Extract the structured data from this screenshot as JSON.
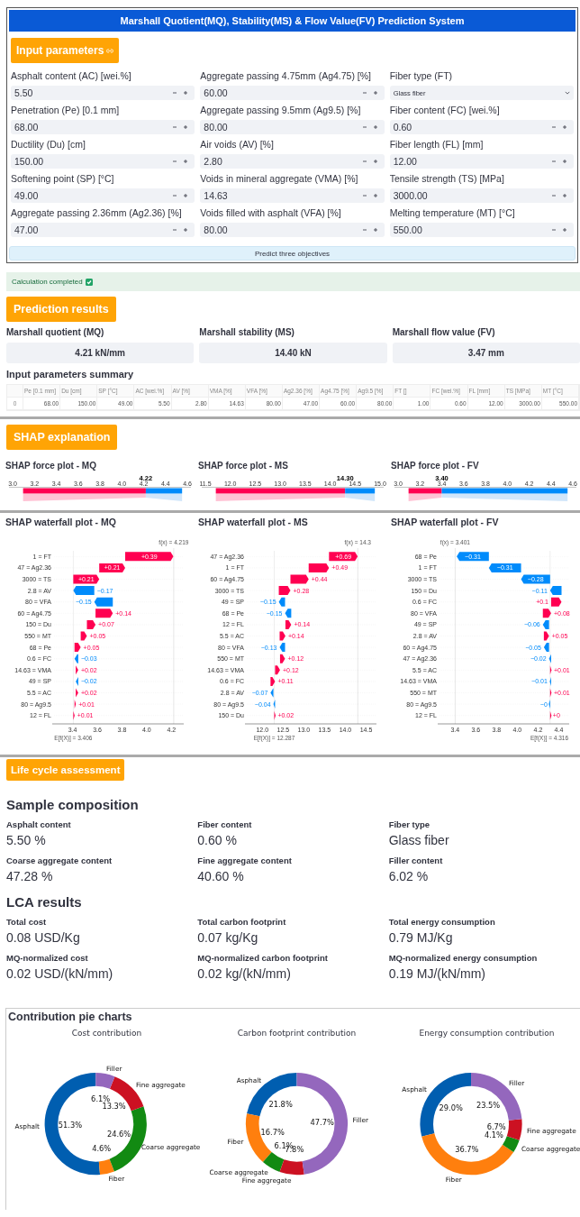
{
  "header": {
    "title": "Marshall Quotient(MQ), Stability(MS) & Flow Value(FV) Prediction System"
  },
  "input_section": {
    "badge": "Input parameters",
    "fields": [
      {
        "label": "Asphalt content (AC) [wei.%]",
        "value": "5.50",
        "kind": "number"
      },
      {
        "label": "Aggregate passing 4.75mm (Ag4.75) [%]",
        "value": "60.00",
        "kind": "number"
      },
      {
        "label": "Fiber type (FT)",
        "value": "Glass fiber",
        "kind": "select"
      },
      {
        "label": "Penetration (Pe) [0.1 mm]",
        "value": "68.00",
        "kind": "number"
      },
      {
        "label": "Aggregate passing 9.5mm (Ag9.5) [%]",
        "value": "80.00",
        "kind": "number"
      },
      {
        "label": "Fiber content (FC) [wei.%]",
        "value": "0.60",
        "kind": "number"
      },
      {
        "label": "Ductility (Du) [cm]",
        "value": "150.00",
        "kind": "number"
      },
      {
        "label": "Air voids (AV) [%]",
        "value": "2.80",
        "kind": "number"
      },
      {
        "label": "Fiber length (FL) [mm]",
        "value": "12.00",
        "kind": "number"
      },
      {
        "label": "Softening point (SP) [°C]",
        "value": "49.00",
        "kind": "number"
      },
      {
        "label": "Voids in mineral aggregate (VMA) [%]",
        "value": "14.63",
        "kind": "number"
      },
      {
        "label": "Tensile strength (TS) [MPa]",
        "value": "3000.00",
        "kind": "number"
      },
      {
        "label": "Aggregate passing 2.36mm (Ag2.36) [%]",
        "value": "47.00",
        "kind": "number"
      },
      {
        "label": "Voids filled with asphalt (VFA) [%]",
        "value": "80.00",
        "kind": "number"
      },
      {
        "label": "Melting temperature (MT) [°C]",
        "value": "550.00",
        "kind": "number"
      }
    ],
    "predict_button": "Predict three objectives"
  },
  "status": {
    "message": "Calculation completed"
  },
  "prediction_section": {
    "badge": "Prediction results",
    "results": [
      {
        "label": "Marshall quotient (MQ)",
        "value": "4.21 kN/mm"
      },
      {
        "label": "Marshall stability (MS)",
        "value": "14.40 kN"
      },
      {
        "label": "Marshall flow value (FV)",
        "value": "3.47 mm"
      }
    ],
    "summary_title": "Input parameters summary",
    "summary_table": {
      "columns": [
        "Pe [0.1 mm]",
        "Du [cm]",
        "SP [°C]",
        "AC [wei.%]",
        "AV [%]",
        "VMA [%]",
        "VFA [%]",
        "Ag2.36 [%]",
        "Ag4.75 [%]",
        "Ag9.5 [%]",
        "FT []",
        "FC [wei.%]",
        "FL [mm]",
        "TS [MPa]",
        "MT [°C]"
      ],
      "rows": [
        {
          "index": "0",
          "cells": [
            "68.00",
            "150.00",
            "49.00",
            "5.50",
            "2.80",
            "14.63",
            "80.00",
            "47.00",
            "60.00",
            "80.00",
            "1.00",
            "0.60",
            "12.00",
            "3000.00",
            "550.00"
          ]
        }
      ]
    }
  },
  "shap_section": {
    "badge": "SHAP explanation",
    "force_plots": [
      {
        "title": "SHAP force plot - MQ",
        "ticks": [
          "3.0",
          "3.2",
          "3.4",
          "3.6",
          "3.8",
          "4.0",
          "4.2",
          "4.4",
          "4.6"
        ],
        "output_label": "4.22"
      },
      {
        "title": "SHAP force plot - MS",
        "ticks": [
          "11.5",
          "12.0",
          "12.5",
          "13.0",
          "13.5",
          "14.0",
          "14.5",
          "15.0"
        ],
        "output_label": "14.30"
      },
      {
        "title": "SHAP force plot - FV",
        "ticks": [
          "3.0",
          "3.2",
          "3.4",
          "3.6",
          "3.8",
          "4.0",
          "4.2",
          "4.4",
          "4.6"
        ],
        "output_label": "3.40"
      }
    ],
    "waterfall_plots": [
      {
        "title": "SHAP waterfall plot - MQ",
        "output_label": "f(x) = 4.219",
        "base_label": "E[f(X)] = 3.406",
        "ticks": [
          "3.4",
          "3.6",
          "3.8",
          "4.0",
          "4.2"
        ],
        "rows": [
          {
            "feature": "1 = FT",
            "contribution": "+0.39"
          },
          {
            "feature": "47 = Ag2.36",
            "contribution": "+0.21"
          },
          {
            "feature": "3000 = TS",
            "contribution": "+0.21"
          },
          {
            "feature": "2.8 = AV",
            "contribution": "−0.17"
          },
          {
            "feature": "80 = VFA",
            "contribution": "−0.15"
          },
          {
            "feature": "60 = Ag4.75",
            "contribution": "+0.14"
          },
          {
            "feature": "150 = Du",
            "contribution": "+0.07"
          },
          {
            "feature": "550 = MT",
            "contribution": "+0.05"
          },
          {
            "feature": "68 = Pe",
            "contribution": "+0.05"
          },
          {
            "feature": "0.6 = FC",
            "contribution": "−0.03"
          },
          {
            "feature": "14.63 = VMA",
            "contribution": "+0.02"
          },
          {
            "feature": "49 = SP",
            "contribution": "−0.02"
          },
          {
            "feature": "5.5 = AC",
            "contribution": "+0.02"
          },
          {
            "feature": "80 = Ag9.5",
            "contribution": "+0.01"
          },
          {
            "feature": "12 = FL",
            "contribution": "+0.01"
          }
        ]
      },
      {
        "title": "SHAP waterfall plot - MS",
        "output_label": "f(x) = 14.3",
        "base_label": "E[f(X)] = 12.287",
        "ticks": [
          "12.0",
          "12.5",
          "13.0",
          "13.5",
          "14.0",
          "14.5"
        ],
        "rows": [
          {
            "feature": "47 = Ag2.36",
            "contribution": "+0.69"
          },
          {
            "feature": "1 = FT",
            "contribution": "+0.49"
          },
          {
            "feature": "60 = Ag4.75",
            "contribution": "+0.44"
          },
          {
            "feature": "3000 = TS",
            "contribution": "+0.28"
          },
          {
            "feature": "49 = SP",
            "contribution": "−0.15"
          },
          {
            "feature": "68 = Pe",
            "contribution": "−0.15"
          },
          {
            "feature": "12 = FL",
            "contribution": "+0.14"
          },
          {
            "feature": "5.5 = AC",
            "contribution": "+0.14"
          },
          {
            "feature": "80 = VFA",
            "contribution": "−0.13"
          },
          {
            "feature": "550 = MT",
            "contribution": "+0.12"
          },
          {
            "feature": "14.63 = VMA",
            "contribution": "+0.12"
          },
          {
            "feature": "0.6 = FC",
            "contribution": "+0.11"
          },
          {
            "feature": "2.8 = AV",
            "contribution": "−0.07"
          },
          {
            "feature": "80 = Ag9.5",
            "contribution": "−0.04"
          },
          {
            "feature": "150 = Du",
            "contribution": "+0.02"
          }
        ]
      },
      {
        "title": "SHAP waterfall plot - FV",
        "output_label": "f(x) = 3.401",
        "base_label": "E[f(X)] = 4.316",
        "ticks": [
          "3.4",
          "3.6",
          "3.8",
          "4.0",
          "4.2",
          "4.4"
        ],
        "rows": [
          {
            "feature": "68 = Pe",
            "contribution": "−0.31"
          },
          {
            "feature": "1 = FT",
            "contribution": "−0.31"
          },
          {
            "feature": "3000 = TS",
            "contribution": "−0.28"
          },
          {
            "feature": "150 = Du",
            "contribution": "−0.11"
          },
          {
            "feature": "0.6 = FC",
            "contribution": "+0.1"
          },
          {
            "feature": "80 = VFA",
            "contribution": "+0.08"
          },
          {
            "feature": "49 = SP",
            "contribution": "−0.06"
          },
          {
            "feature": "2.8 = AV",
            "contribution": "+0.05"
          },
          {
            "feature": "60 = Ag4.75",
            "contribution": "−0.05"
          },
          {
            "feature": "47 = Ag2.36",
            "contribution": "−0.02"
          },
          {
            "feature": "5.5 = AC",
            "contribution": "+0.01"
          },
          {
            "feature": "14.63 = VMA",
            "contribution": "−0.01"
          },
          {
            "feature": "550 = MT",
            "contribution": "+0.01"
          },
          {
            "feature": "80 = Ag9.5",
            "contribution": "−0"
          },
          {
            "feature": "12 = FL",
            "contribution": "+0"
          }
        ]
      }
    ]
  },
  "lca_section": {
    "badge": "Life cycle assessment",
    "groups": [
      {
        "title": "Sample composition",
        "metrics": [
          {
            "label": "Asphalt content",
            "value": "5.50 %"
          },
          {
            "label": "Fiber content",
            "value": "0.60 %"
          },
          {
            "label": "Fiber type",
            "value": "Glass fiber"
          },
          {
            "label": "Coarse aggregate content",
            "value": "47.28 %"
          },
          {
            "label": "Fine aggregate content",
            "value": "40.60 %"
          },
          {
            "label": "Filler content",
            "value": "6.02 %"
          }
        ]
      },
      {
        "title": "LCA results",
        "metrics": [
          {
            "label": "Total cost",
            "value": "0.08 USD/Kg"
          },
          {
            "label": "Total carbon footprint",
            "value": "0.07 kg/Kg"
          },
          {
            "label": "Total energy consumption",
            "value": "0.79 MJ/Kg"
          },
          {
            "label": "MQ-normalized cost",
            "value": "0.02 USD/(kN/mm)"
          },
          {
            "label": "MQ-normalized carbon footprint",
            "value": "0.02 kg/(kN/mm)"
          },
          {
            "label": "MQ-normalized energy consumption",
            "value": "0.19 MJ/(kN/mm)"
          }
        ]
      }
    ]
  },
  "pie_section": {
    "title": "Contribution pie charts",
    "charts": [
      {
        "chart_data": {
          "type": "donut",
          "title": "Cost contribution",
          "categories": [
            "Asphalt",
            "Fiber",
            "Coarse aggregate",
            "Fine aggregate",
            "Filler"
          ],
          "values": [
            51.3,
            4.6,
            24.6,
            13.3,
            6.1
          ],
          "value_labels": [
            "51.3%",
            "4.6%",
            "24.6%",
            "13.3%",
            "6.1%"
          ],
          "colors": [
            "#005eb0",
            "#ff7f0e",
            "#128a12",
            "#cc1122",
            "#9467bd"
          ]
        }
      },
      {
        "chart_data": {
          "type": "donut",
          "title": "Carbon footprint contribution",
          "categories": [
            "Asphalt",
            "Fiber",
            "Coarse aggregate",
            "Fine aggregate",
            "Filler"
          ],
          "values": [
            21.8,
            16.7,
            6.1,
            7.8,
            47.7
          ],
          "value_labels": [
            "21.8%",
            "16.7%",
            "6.1%",
            "7.8%",
            "47.7%"
          ],
          "colors": [
            "#005eb0",
            "#ff7f0e",
            "#128a12",
            "#cc1122",
            "#9467bd"
          ]
        }
      },
      {
        "chart_data": {
          "type": "donut",
          "title": "Energy consumption contribution",
          "categories": [
            "Asphalt",
            "Fiber",
            "Coarse aggregate",
            "Fine aggregate",
            "Filler"
          ],
          "values": [
            29.0,
            36.7,
            4.1,
            6.7,
            23.5
          ],
          "value_labels": [
            "29.0%",
            "36.7%",
            "4.1%",
            "6.7%",
            "23.5%"
          ],
          "colors": [
            "#005eb0",
            "#ff7f0e",
            "#128a12",
            "#cc1122",
            "#9467bd"
          ]
        }
      }
    ]
  }
}
